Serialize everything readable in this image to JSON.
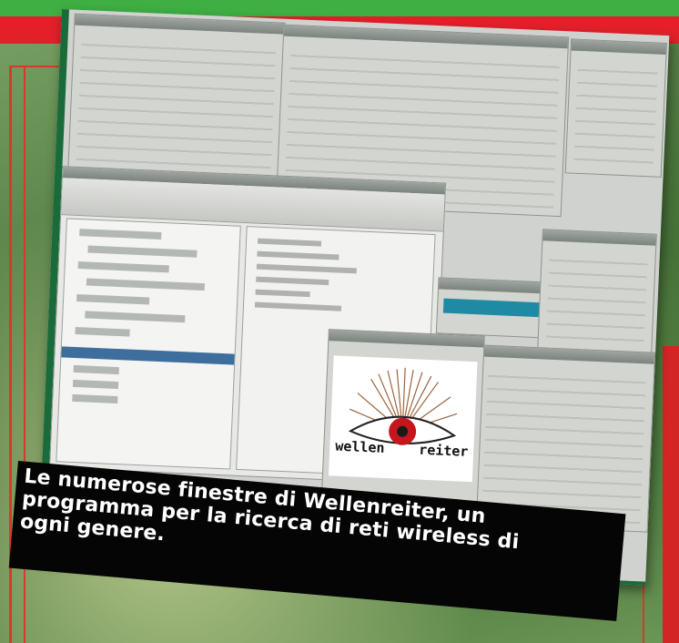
{
  "caption": {
    "text": "Le numerose finestre di Wellenreiter, un\nprogramma per la ricerca di reti wireless di\nogni genere."
  },
  "screenshot": {
    "logo": {
      "word_left": "wellen",
      "word_right": "reiter",
      "iris_color": "#c4161c"
    }
  },
  "colors": {
    "top_band": "#3fae43",
    "red_band": "#e3202a",
    "caption_background": "#050505",
    "frame_accent": "#1a6b3a"
  }
}
